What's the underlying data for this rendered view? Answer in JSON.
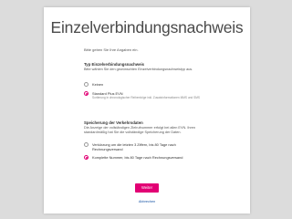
{
  "page": {
    "title": "Einzelverbindungsnachweis",
    "intro": "Bitte geben Sie Ihre Angaben ein."
  },
  "accent_color": "#e20074",
  "type_section": {
    "title": "Typ Einzelverbindungsnachweis",
    "description": "Bitte wählen Sie den gewünschten Einzelverbindungsnachweistyp aus.",
    "options": [
      {
        "label": "Keinen",
        "sub": "",
        "checked": false
      },
      {
        "label": "Standard Plus EVN",
        "sub": "Sortierung in chronologischer Reihenfolge inkl. Zusatzinformationen MMS und SMS",
        "checked": true
      }
    ]
  },
  "storage_section": {
    "title": "Speicherung der Verkehrsdaten",
    "description": "Die Anzeige der vollständigen Zielrufnummer erfolgt bei allen EVN. Ihren standardmäßig hat Sie die vollständige Speicherung der Daten.",
    "options": [
      {
        "label": "Verkürzung um die letzten 3 Ziffern, bis 80 Tage nach Rechnungsversand",
        "checked": false
      },
      {
        "label": "Komplette Nummer, bis 80 Tage nach Rechnungsversand",
        "checked": true
      }
    ]
  },
  "actions": {
    "submit_label": "Weiter",
    "cancel_label": "Abbrechen"
  }
}
